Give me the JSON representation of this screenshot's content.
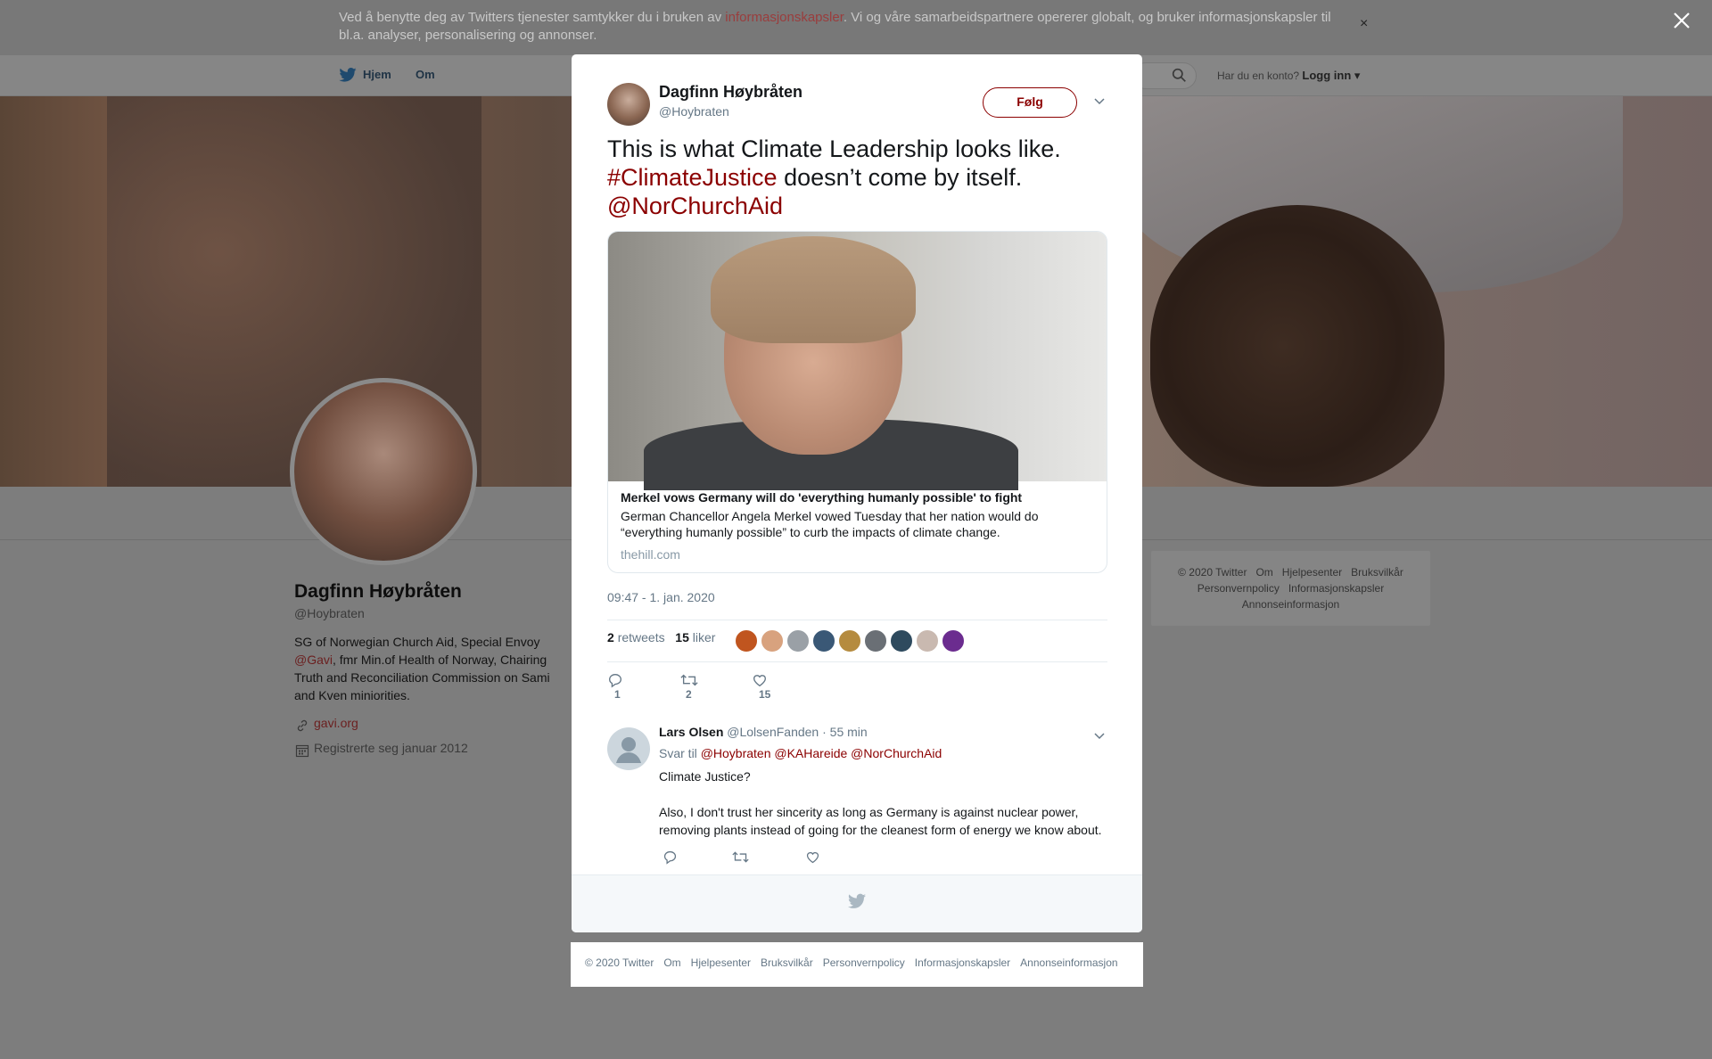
{
  "cookie": {
    "text_before": "Ved å benytte deg av Twitters tjenester samtykker du i bruken av ",
    "link": "informasjonskapsler",
    "text_after": ". Vi og våre samarbeidspartnere opererer globalt, og bruker informasjonskapsler til bl.a. analyser, personalisering og annonser.",
    "close": "×"
  },
  "nav": {
    "home": "Hjem",
    "about": "Om",
    "account_prompt": "Har du en konto?",
    "login": "Logg inn"
  },
  "profile": {
    "name": "Dagfinn Høybråten",
    "handle": "@Hoybraten",
    "bio_1": "SG of Norwegian Church Aid, Special Envoy ",
    "bio_link": "@Gavi",
    "bio_2": ", fmr Min.of Health of Norway, Chairing Truth and Reconciliation Commission on Sami and Kven miniorities.",
    "website": "gavi.org",
    "joined": "Registrerte seg januar 2012"
  },
  "side_footer": {
    "items": [
      "© 2020 Twitter",
      "Om",
      "Hjelpesenter",
      "Bruksvilkår",
      "Personvernpolicy",
      "Informasjonskapsler",
      "Annonseinformasjon"
    ]
  },
  "tweet": {
    "name": "Dagfinn Høybråten",
    "handle": "@Hoybraten",
    "follow": "Følg",
    "text_1": "This is what Climate Leadership looks like. ",
    "hashtag": "#ClimateJustice",
    "text_2": " doesn’t come by itself. ",
    "mention": "@NorChurchAid",
    "card": {
      "title": "Merkel vows Germany will do 'everything humanly possible' to fight",
      "description": "German Chancellor Angela Merkel vowed Tuesday that her nation would do “everything humanly possible” to curb the impacts of climate change.",
      "domain": "thehill.com"
    },
    "timestamp": "09:47 - 1. jan. 2020",
    "retweets_count": "2",
    "retweets_label": "retweets",
    "likes_count": "15",
    "likes_label": "liker",
    "actions": {
      "replies": "1",
      "retweets": "2",
      "likes": "15"
    },
    "liker_colors": [
      "#c0551f",
      "#d8a27e",
      "#9aa0a6",
      "#3a5876",
      "#b58b3f",
      "#6a6f75",
      "#2e4a5e",
      "#c9b9b0",
      "#6b2c8f"
    ]
  },
  "reply": {
    "name": "Lars Olsen",
    "handle": "@LolsenFanden",
    "time": "· 55 min",
    "reply_to_label": "Svar til",
    "mentions": "@Hoybraten @KAHareide @NorChurchAid",
    "body_1": "Climate Justice?",
    "body_2": "Also, I don't trust her sincerity as long as Germany is against nuclear power, removing plants instead of going for the cleanest form of energy we know about."
  },
  "footer_links": [
    "© 2020 Twitter",
    "Om",
    "Hjelpesenter",
    "Bruksvilkår",
    "Personvernpolicy",
    "Informasjonskapsler",
    "Annonseinformasjon"
  ]
}
